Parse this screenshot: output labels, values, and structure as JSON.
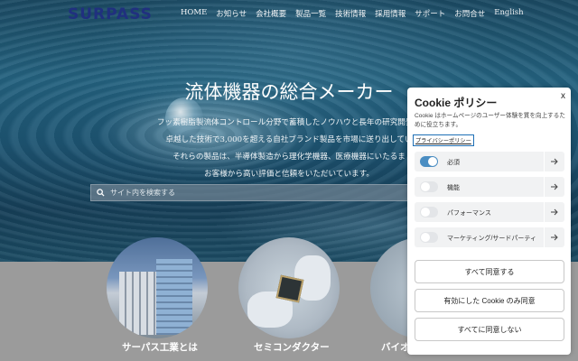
{
  "header": {
    "logo": "SURPASS",
    "nav": [
      "HOME",
      "お知らせ",
      "会社概要",
      "製品一覧",
      "技術情報",
      "採用情報",
      "サポート",
      "お問合せ",
      "English"
    ]
  },
  "hero": {
    "title": "流体機器の総合メーカー",
    "description": [
      "フッ素樹脂製流体コントロール分野で蓄積したノウハウと長年の研究開発の",
      "卓越した技術で3,000を超える自社ブランド製品を市場に送り出してい",
      "それらの製品は、半導体製造から理化学機器、医療機器にいたるま",
      "お客様から高い評価と信頼をいただいています。"
    ],
    "search_placeholder": "サイト内を検索する"
  },
  "features": [
    {
      "caption": "サーパス工業とは"
    },
    {
      "caption": "セミコンダクター"
    },
    {
      "caption": "バイオ"
    }
  ],
  "cookie": {
    "title": "Cookie ポリシー",
    "close": "x",
    "description": "Cookie はホームページのユーザー体験を質を向上するために役立ちます。",
    "privacy_link": "プライバシーポリシー",
    "categories": [
      {
        "label": "必須",
        "enabled": true
      },
      {
        "label": "機能",
        "enabled": false
      },
      {
        "label": "パフォーマンス",
        "enabled": false
      },
      {
        "label": "マーケティング/サードパーティ",
        "enabled": false
      }
    ],
    "buttons": {
      "accept_all": "すべて同意する",
      "accept_enabled": "有効にした Cookie のみ同意",
      "reject_all": "すべてに同意しない"
    }
  },
  "colors": {
    "accent": "#4a8dc2",
    "logo": "#20307f"
  }
}
